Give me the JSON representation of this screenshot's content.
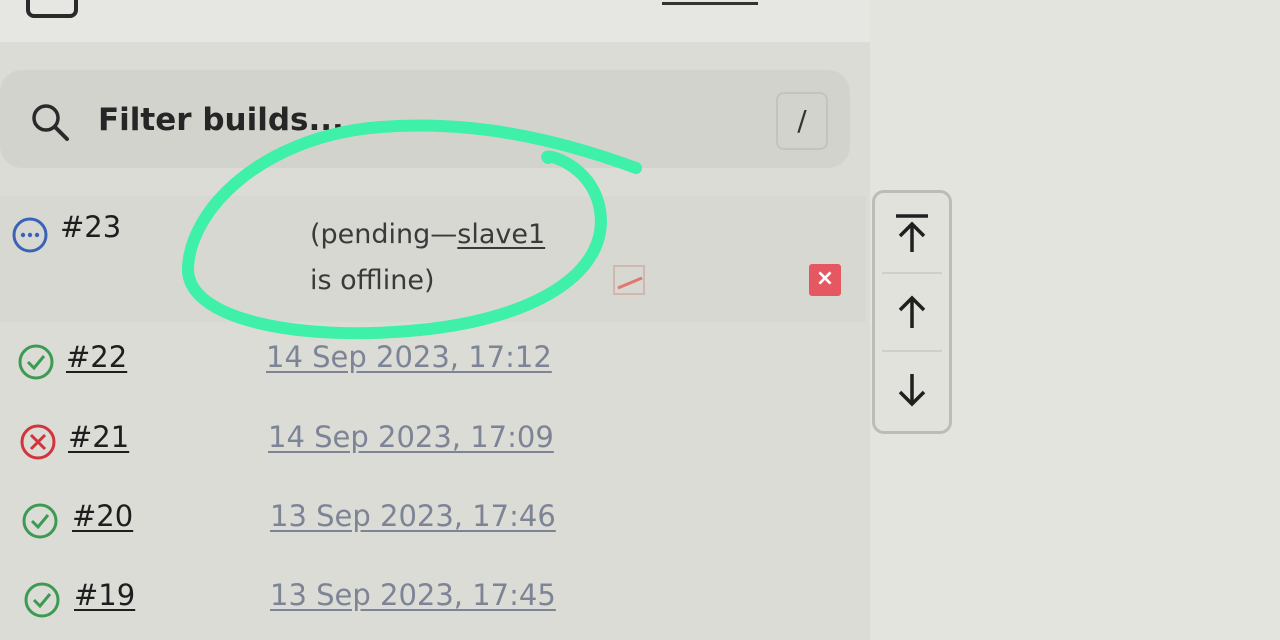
{
  "search": {
    "placeholder": "Filter builds...",
    "shortcut": "/"
  },
  "builds": [
    {
      "number": "#23",
      "status": "pending",
      "pending_prefix": "(pending—",
      "pending_node": "slave1",
      "pending_suffix": "is offline)"
    },
    {
      "number": "#22",
      "status": "success",
      "date": "14 Sep 2023, 17:12"
    },
    {
      "number": "#21",
      "status": "failed",
      "date": "14 Sep 2023, 17:09"
    },
    {
      "number": "#20",
      "status": "success",
      "date": "13 Sep 2023, 17:46"
    },
    {
      "number": "#19",
      "status": "success",
      "date": "13 Sep 2023, 17:45"
    }
  ],
  "icons": {
    "pending": "pending-dots-icon",
    "success": "check-circle-icon",
    "failed": "x-circle-icon",
    "search": "search-icon",
    "edit": "edit-icon",
    "cancel": "cancel-icon",
    "scroll_top": "arrow-to-top-icon",
    "scroll_up": "arrow-up-icon",
    "scroll_down": "arrow-down-icon"
  },
  "colors": {
    "pending": "#3a63b8",
    "success": "#3c9a52",
    "failed": "#d1343c",
    "cancel": "#e55862",
    "annotation": "#3ef0a8",
    "date_link": "#7d8496"
  }
}
